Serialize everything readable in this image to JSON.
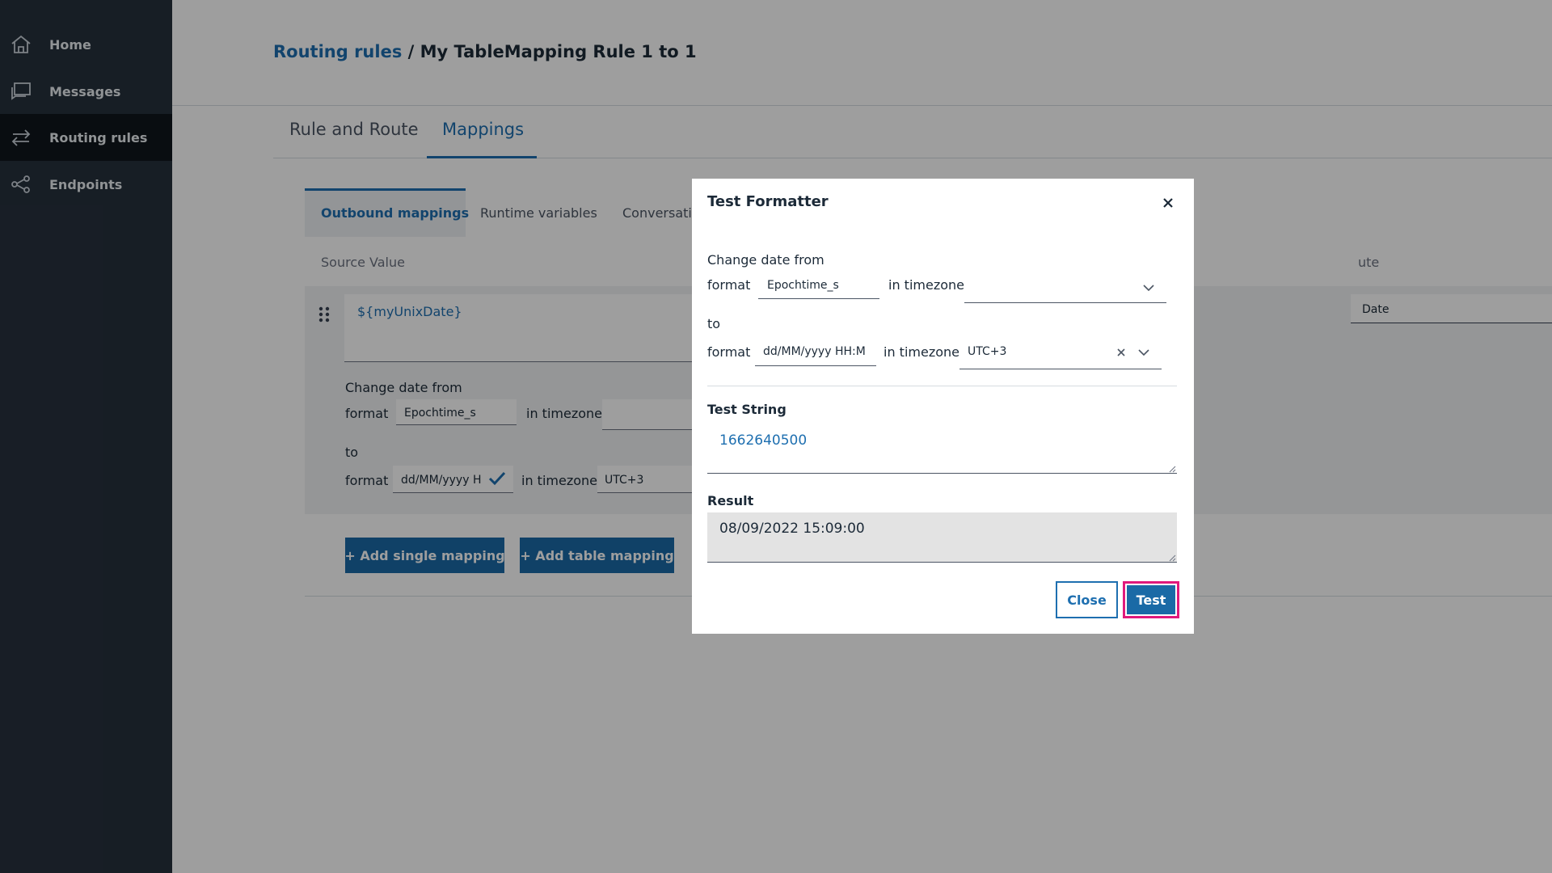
{
  "sidebar": {
    "items": [
      {
        "label": "Home",
        "icon": "home-icon"
      },
      {
        "label": "Messages",
        "icon": "messages-icon"
      },
      {
        "label": "Routing rules",
        "icon": "routing-icon"
      },
      {
        "label": "Endpoints",
        "icon": "endpoints-icon"
      }
    ]
  },
  "breadcrumb": {
    "parent": "Routing rules",
    "separator": " / ",
    "current": "My TableMapping Rule 1 to 1"
  },
  "tabs": [
    {
      "label": "Rule and Route"
    },
    {
      "label": "Mappings"
    }
  ],
  "sub_tabs": [
    {
      "label": "Outbound mappings"
    },
    {
      "label": "Runtime variables"
    },
    {
      "label": "Conversati"
    }
  ],
  "columns": {
    "source": "Source Value",
    "target_partial": "ute"
  },
  "mapping": {
    "source_value": "${myUnixDate}",
    "target_partial": "Date",
    "change_date_from": "Change date from",
    "format_label": "format",
    "from_format": "Epochtime_s",
    "in_timezone": "in timezone",
    "to_label": "to",
    "to_format": "dd/MM/yyyy H",
    "to_timezone": "UTC+3"
  },
  "buttons": {
    "add_single": "+ Add single mapping",
    "add_table": "+ Add table mapping"
  },
  "modal": {
    "title": "Test Formatter",
    "change_date_from": "Change date from",
    "format_label": "format",
    "from_format": "Epochtime_s",
    "in_timezone": "in timezone",
    "from_timezone": "",
    "to_label": "to",
    "to_format": "dd/MM/yyyy HH:M",
    "to_timezone": "UTC+3",
    "test_string_label": "Test String",
    "test_string_value": "1662640500",
    "result_label": "Result",
    "result_value": "08/09/2022 15:09:00",
    "close_label": "Close",
    "test_label": "Test"
  },
  "colors": {
    "sidebar": "#26313d",
    "accent": "#1e6fb0",
    "highlight": "#e0197c"
  }
}
